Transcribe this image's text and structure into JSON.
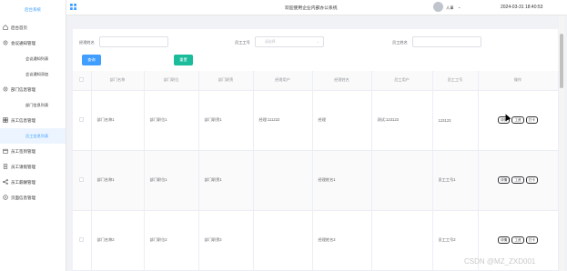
{
  "sidebar": {
    "brand": "后台系统",
    "items": [
      {
        "label": "后台首页",
        "icon": "home-icon"
      },
      {
        "label": "会议通知管理",
        "icon": "setting-icon",
        "children": [
          "会议通知列表",
          "会议通知添加"
        ]
      },
      {
        "label": "部门信息管理",
        "icon": "setting-icon",
        "children": [
          "部门信息列表"
        ]
      },
      {
        "label": "员工信息管理",
        "icon": "grid-icon",
        "children": [
          "员工信息列表"
        ]
      },
      {
        "label": "员工签到管理",
        "icon": "calendar-icon"
      },
      {
        "label": "员工请假管理",
        "icon": "document-icon"
      },
      {
        "label": "员工薪酬管理",
        "icon": "share-icon"
      },
      {
        "label": "页面信息管理",
        "icon": "compass-icon"
      }
    ],
    "active_child": "员工信息列表"
  },
  "header": {
    "title": "欢迎使用企业内部办公系统",
    "user": "人事",
    "datetime": "2024-03-31 18:40:53"
  },
  "filters": {
    "manager_name_label": "经理姓名",
    "employee_id_label": "员工工号",
    "employee_id_placeholder": "请选择",
    "employee_name_label": "员工姓名",
    "search_label": "查询",
    "reset_label": "重置"
  },
  "table": {
    "headers": [
      "部门名称",
      "部门职位",
      "部门职责",
      "经理用户",
      "经理姓名",
      "员工用户",
      "员工工号",
      "操作"
    ],
    "rows": [
      {
        "cells": [
          "部门名称1",
          "部门职位1",
          "部门职责1",
          "经理:111222",
          "经理",
          "测试:123123",
          "123123"
        ]
      },
      {
        "cells": [
          "部门名称1",
          "部门职位1",
          "部门职责1",
          "",
          "经理姓名1",
          "",
          "员工工号1"
        ]
      },
      {
        "cells": [
          "部门名称2",
          "部门职位2",
          "部门职责2",
          "",
          "经理姓名2",
          "",
          "员工工号2"
        ]
      }
    ],
    "actions": [
      "详情",
      "工资",
      "打卡"
    ]
  },
  "watermark": "CSDN @MZ_ZXD001"
}
